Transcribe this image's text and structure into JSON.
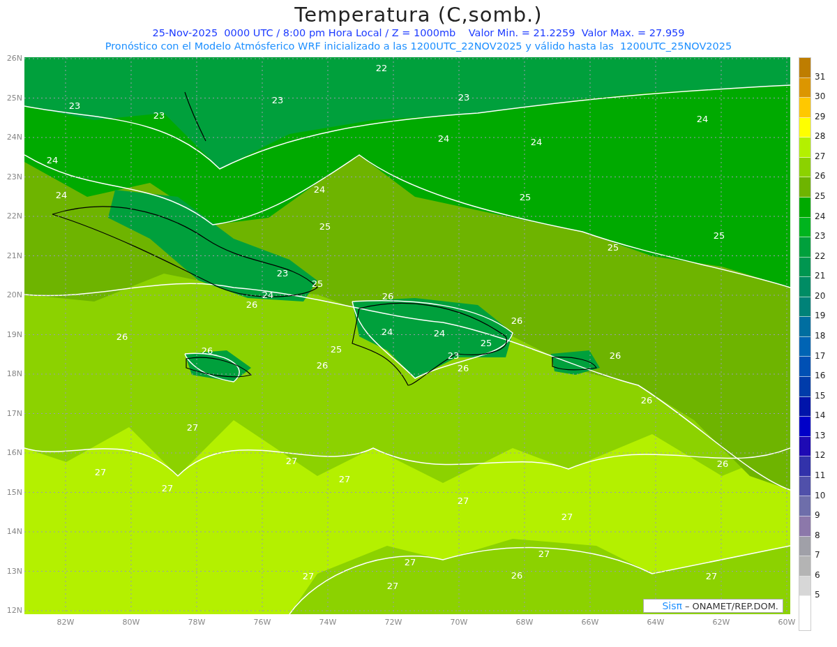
{
  "title": "Temperatura (C,somb.)",
  "subtitle_lines": [
    "25-Nov-2025  0000 UTC / 8:00 pm Hora Local / Z = 1000mb    Valor Min. = 21.2259  Valor Max. = 27.959",
    "Pronóstico con el Modelo Atmósferico WRF inicializado a las 1200UTC_22NOV2025 y válido hasta las  1200UTC_25NOV2025"
  ],
  "map": {
    "latitude_labels": [
      "26N",
      "25N",
      "24N",
      "23N",
      "22N",
      "21N",
      "20N",
      "19N",
      "18N",
      "17N",
      "16N",
      "15N",
      "14N",
      "13N",
      "12N"
    ],
    "longitude_labels": [
      "82W",
      "80W",
      "78W",
      "76W",
      "74W",
      "72W",
      "70W",
      "68W",
      "66W",
      "64W",
      "62W",
      "60W"
    ],
    "contour_labels": [
      "22",
      "23",
      "23",
      "23",
      "23",
      "24",
      "24",
      "24",
      "24",
      "24",
      "24",
      "25",
      "25",
      "25",
      "25",
      "23",
      "25",
      "24",
      "26",
      "26",
      "26",
      "24",
      "24",
      "25",
      "26",
      "26",
      "25",
      "26",
      "23",
      "26",
      "26",
      "26",
      "27",
      "26",
      "27",
      "27",
      "27",
      "27",
      "27",
      "27",
      "27",
      "27",
      "27",
      "26",
      "27",
      "27"
    ],
    "credit": {
      "logo": "Sisπ",
      "text": "– ONAMET/REP.DOM."
    }
  },
  "colorbar": {
    "items": [
      {
        "color": "#be7d00",
        "label": "31"
      },
      {
        "color": "#dc9600",
        "label": "30"
      },
      {
        "color": "#ffc800",
        "label": "29"
      },
      {
        "color": "#ffff00",
        "label": "28"
      },
      {
        "color": "#b4f000",
        "label": "27"
      },
      {
        "color": "#8cd200",
        "label": "26"
      },
      {
        "color": "#6eb400",
        "label": "25"
      },
      {
        "color": "#00aa00",
        "label": "24"
      },
      {
        "color": "#00b41e",
        "label": "23"
      },
      {
        "color": "#00a03c",
        "label": "22"
      },
      {
        "color": "#009650",
        "label": "21"
      },
      {
        "color": "#008c64",
        "label": "20"
      },
      {
        "color": "#008278",
        "label": "19"
      },
      {
        "color": "#006ea0",
        "label": "18"
      },
      {
        "color": "#0064b4",
        "label": "17"
      },
      {
        "color": "#0050b4",
        "label": "16"
      },
      {
        "color": "#003caa",
        "label": "15"
      },
      {
        "color": "#0014aa",
        "label": "14"
      },
      {
        "color": "#0000c8",
        "label": "13"
      },
      {
        "color": "#1e0ab4",
        "label": "12"
      },
      {
        "color": "#3232aa",
        "label": "11"
      },
      {
        "color": "#5050aa",
        "label": "10"
      },
      {
        "color": "#6e6eaa",
        "label": "9"
      },
      {
        "color": "#8c78aa",
        "label": "8"
      },
      {
        "color": "#a0a0a8",
        "label": "7"
      },
      {
        "color": "#b4b4b4",
        "label": "6"
      },
      {
        "color": "#d7d7d7",
        "label": "5"
      }
    ]
  }
}
